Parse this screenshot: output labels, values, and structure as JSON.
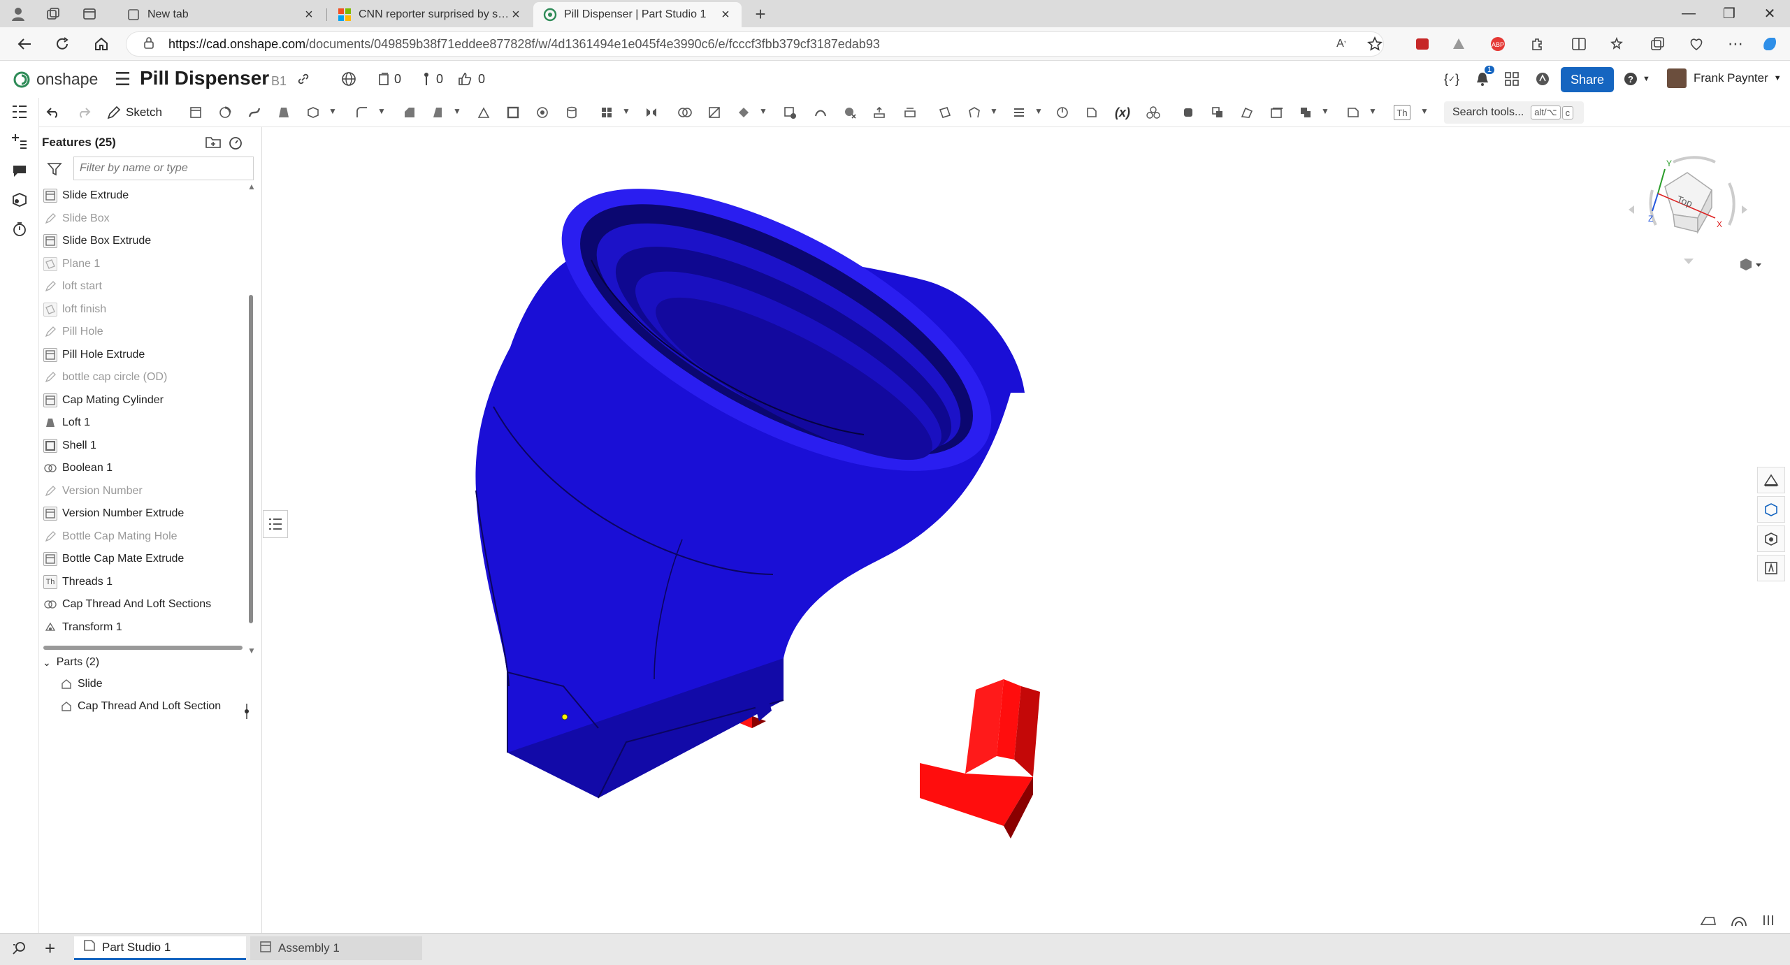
{
  "browser": {
    "tabs": [
      {
        "title": "New tab"
      },
      {
        "title": "CNN reporter surprised by size o"
      },
      {
        "title": "Pill Dispenser | Part Studio 1"
      }
    ],
    "new_tab": "+",
    "url_host": "https://cad.onshape.com",
    "url_path": "/documents/049859b38f71eddee877828f/w/4d1361494e1e045f4e3990c6/e/fcccf3fbb379cf3187edab93"
  },
  "header": {
    "logo_text": "onshape",
    "doc_title": "Pill Dispenser",
    "branch": "B1",
    "counters": {
      "versions": "0",
      "branches": "0",
      "likes": "0"
    },
    "notifications": "1",
    "share_label": "Share",
    "user_name": "Frank Paynter"
  },
  "toolbar": {
    "sketch_label": "Sketch",
    "search_placeholder": "Search tools...",
    "search_kbd1": "alt/⌥",
    "search_kbd2": "c",
    "thread_icon_label": "Th",
    "variable_icon_label": "(x)"
  },
  "features": {
    "title": "Features (25)",
    "filter_placeholder": "Filter by name or type",
    "items": [
      {
        "label": "Slide Extrude",
        "kind": "extrude",
        "suppressed": false
      },
      {
        "label": "Slide Box",
        "kind": "sketch",
        "suppressed": true
      },
      {
        "label": "Slide Box Extrude",
        "kind": "extrude",
        "suppressed": false
      },
      {
        "label": "Plane 1",
        "kind": "plane",
        "suppressed": true
      },
      {
        "label": "loft start",
        "kind": "sketch",
        "suppressed": true
      },
      {
        "label": "loft finish",
        "kind": "plane",
        "suppressed": true
      },
      {
        "label": "Pill Hole",
        "kind": "sketch",
        "suppressed": true
      },
      {
        "label": "Pill Hole Extrude",
        "kind": "extrude",
        "suppressed": false
      },
      {
        "label": "bottle cap circle (OD)",
        "kind": "sketch",
        "suppressed": true
      },
      {
        "label": "Cap Mating Cylinder",
        "kind": "extrude",
        "suppressed": false
      },
      {
        "label": "Loft 1",
        "kind": "loft",
        "suppressed": false
      },
      {
        "label": "Shell 1",
        "kind": "shell",
        "suppressed": false
      },
      {
        "label": "Boolean 1",
        "kind": "boolean",
        "suppressed": false
      },
      {
        "label": "Version Number",
        "kind": "sketch",
        "suppressed": true
      },
      {
        "label": "Version Number Extrude",
        "kind": "extrude",
        "suppressed": false
      },
      {
        "label": "Bottle Cap Mating Hole",
        "kind": "sketch",
        "suppressed": true
      },
      {
        "label": "Bottle Cap Mate Extrude",
        "kind": "extrude",
        "suppressed": false
      },
      {
        "label": "Threads 1",
        "kind": "threads",
        "suppressed": false
      },
      {
        "label": "Cap Thread And Loft Sections",
        "kind": "boolean",
        "suppressed": false
      },
      {
        "label": "Transform 1",
        "kind": "transform",
        "suppressed": false
      }
    ]
  },
  "parts": {
    "title": "Parts (2)",
    "items": [
      {
        "label": "Slide"
      },
      {
        "label": "Cap Thread And Loft Section"
      }
    ]
  },
  "viewcube": {
    "face_label": "Top",
    "axis_x": "X",
    "axis_y": "Y",
    "axis_z": "Z"
  },
  "bottom_tabs": [
    {
      "label": "Part Studio 1",
      "active": true
    },
    {
      "label": "Assembly 1",
      "active": false
    }
  ],
  "colors": {
    "funnel_blue": "#1a0fd6",
    "slide_red": "#ff0d0d",
    "share_blue": "#1565c0",
    "onshape_green": "#2e8b57"
  }
}
